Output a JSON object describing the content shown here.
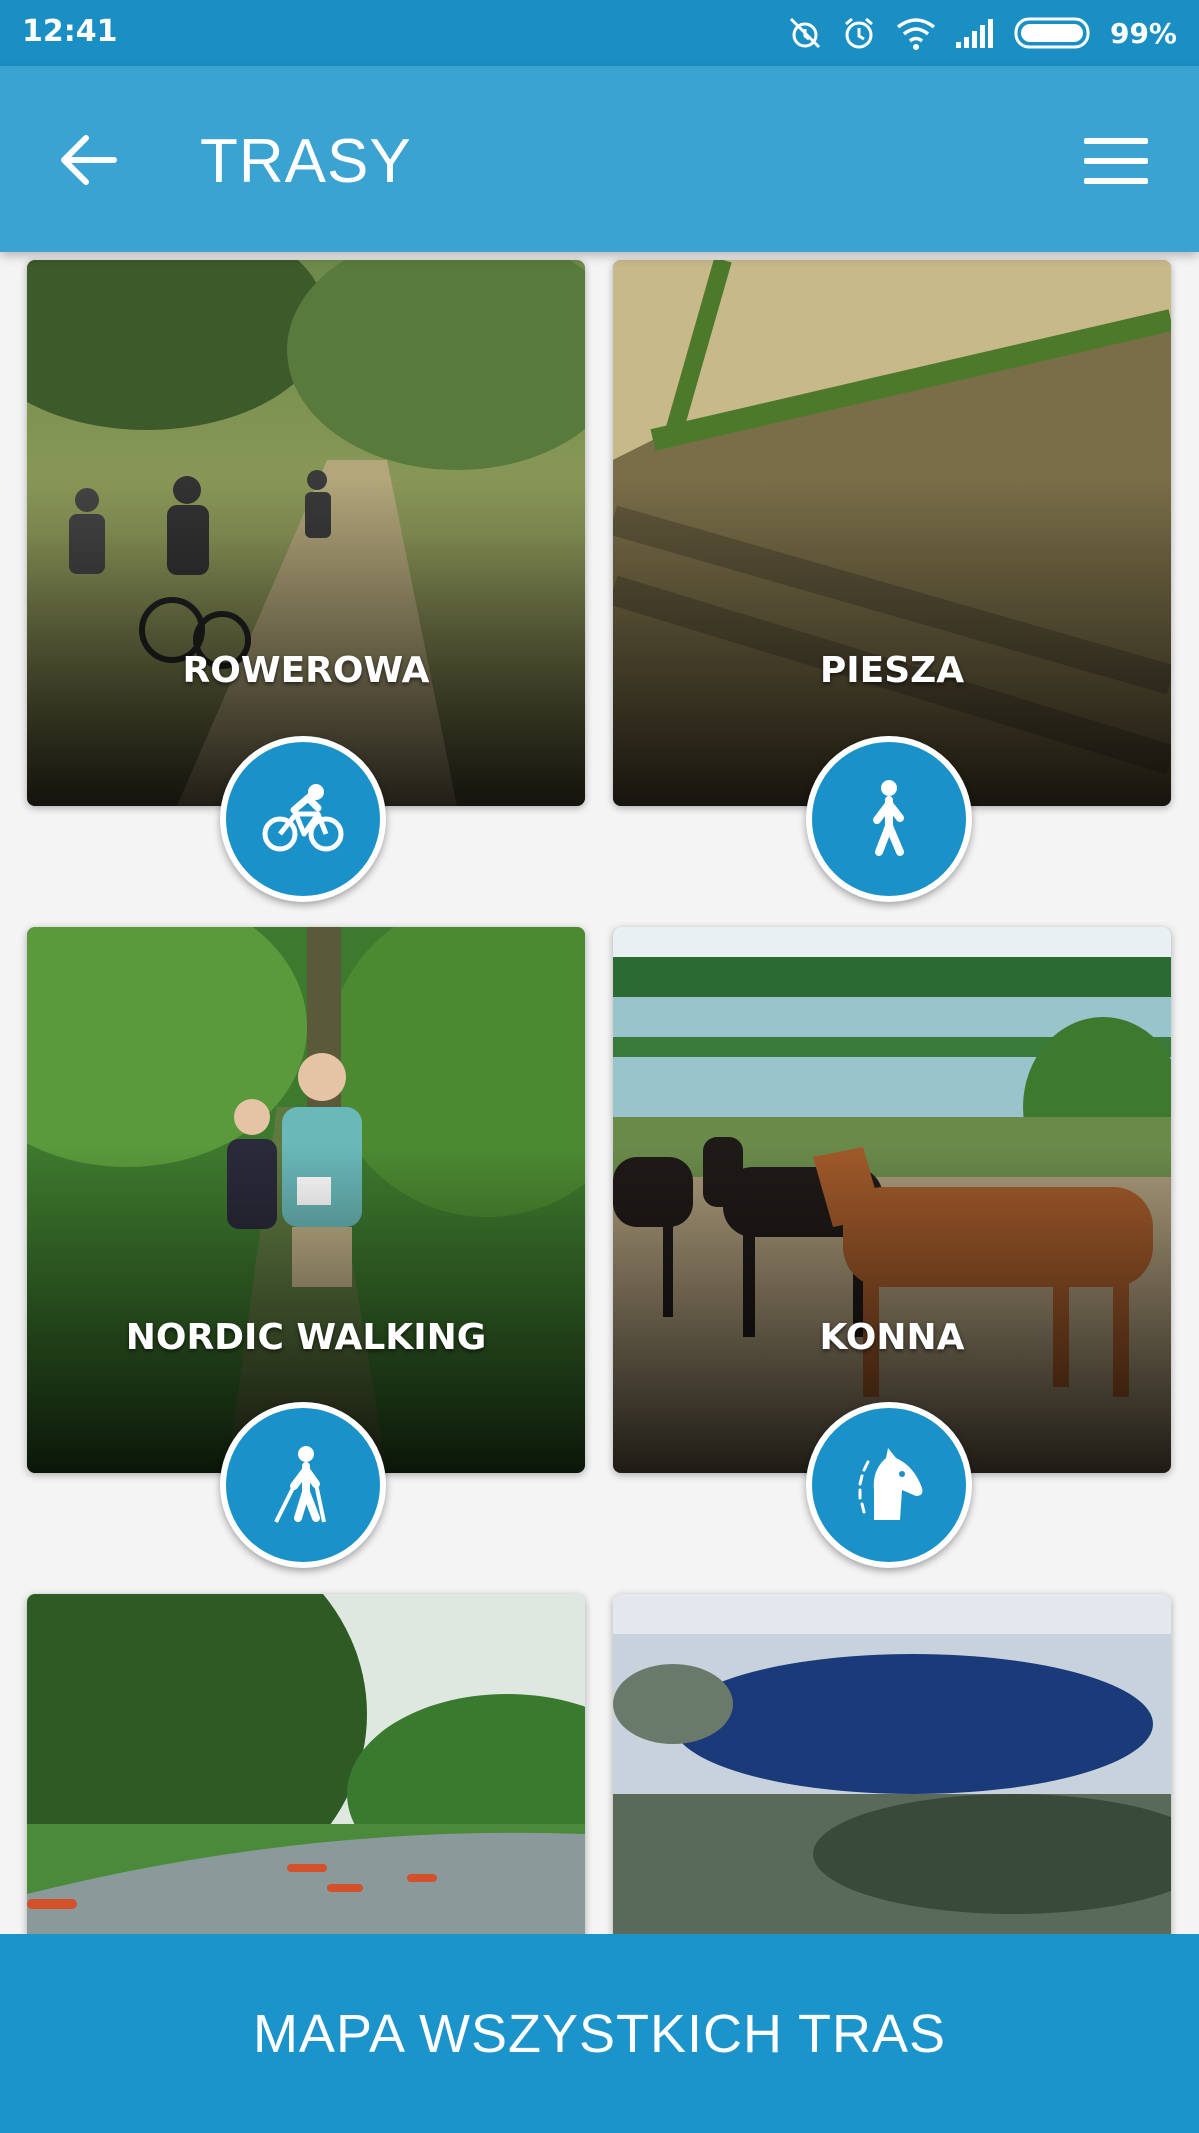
{
  "status_bar": {
    "time": "12:41",
    "battery": "99%",
    "icons": [
      "alarm-off-icon",
      "alarm-icon",
      "wifi-icon",
      "signal-icon",
      "battery-icon"
    ]
  },
  "app_bar": {
    "title": "TRASY",
    "back_icon": "arrow-left-icon",
    "menu_icon": "hamburger-menu-icon"
  },
  "routes": [
    {
      "label": "ROWEROWA",
      "icon": "bicycle-icon"
    },
    {
      "label": "PIESZA",
      "icon": "walking-icon"
    },
    {
      "label": "NORDIC WALKING",
      "icon": "nordic-walking-icon"
    },
    {
      "label": "KONNA",
      "icon": "horse-head-icon"
    },
    {
      "label": "",
      "icon": ""
    },
    {
      "label": "",
      "icon": ""
    }
  ],
  "bottom_button": {
    "label": "MAPA WSZYSTKICH TRAS"
  },
  "colors": {
    "status_bar": "#1a8fc4",
    "app_bar": "#3ba3d2",
    "badge": "#1a91c9",
    "bottom_bar": "#1b93cb"
  }
}
